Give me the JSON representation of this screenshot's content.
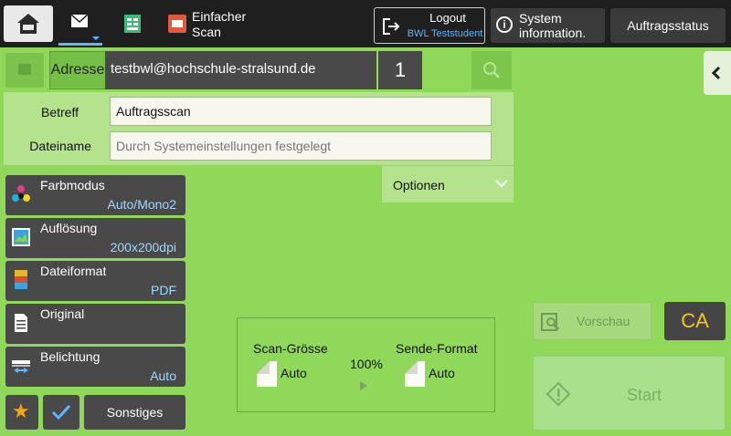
{
  "colors": {
    "background": "#8fd85a",
    "button_dark": "#494949",
    "accent_blue": "#5db6ff",
    "ca_yellow": "#f4c61c",
    "star_orange": "#f0a51a"
  },
  "header": {
    "tabs": [
      {
        "icon": "home-icon"
      },
      {
        "icon": "email-icon"
      },
      {
        "icon": "document-icon"
      },
      {
        "icon": "scan-icon",
        "label": "Einfacher\nScan"
      }
    ],
    "logout": {
      "label": "Logout",
      "user": "BWL Teststudent"
    },
    "sysinfo_label": "System\ninformation.",
    "auftragsstatus_label": "Auftragsstatus"
  },
  "address": {
    "label": "Adresse",
    "value": "testbwl@hochschule-stralsund.de",
    "count": "1"
  },
  "form": {
    "betreff_label": "Betreff",
    "betreff_value": "Auftragsscan",
    "dateiname_label": "Dateiname",
    "dateiname_placeholder": "Durch Systemeinstellungen festgelegt"
  },
  "optionen_label": "Optionen",
  "settings": [
    {
      "label": "Farbmodus",
      "value": "Auto/Mono2",
      "icon": "color-mode-icon"
    },
    {
      "label": "Auflösung",
      "value": "200x200dpi",
      "icon": "resolution-icon"
    },
    {
      "label": "Dateiformat",
      "value": "PDF",
      "icon": "file-format-icon"
    },
    {
      "label": "Original",
      "value": "",
      "icon": "original-icon"
    },
    {
      "label": "Belichtung",
      "value": "Auto",
      "icon": "exposure-icon"
    }
  ],
  "bottom": {
    "sonstiges_label": "Sonstiges"
  },
  "summary": {
    "scan_size_label": "Scan-Grösse",
    "scan_size_value": "Auto",
    "ratio": "100%",
    "send_format_label": "Sende-Format",
    "send_format_value": "Auto"
  },
  "actions": {
    "preview_label": "Vorschau",
    "ca_label": "CA",
    "start_label": "Start"
  }
}
